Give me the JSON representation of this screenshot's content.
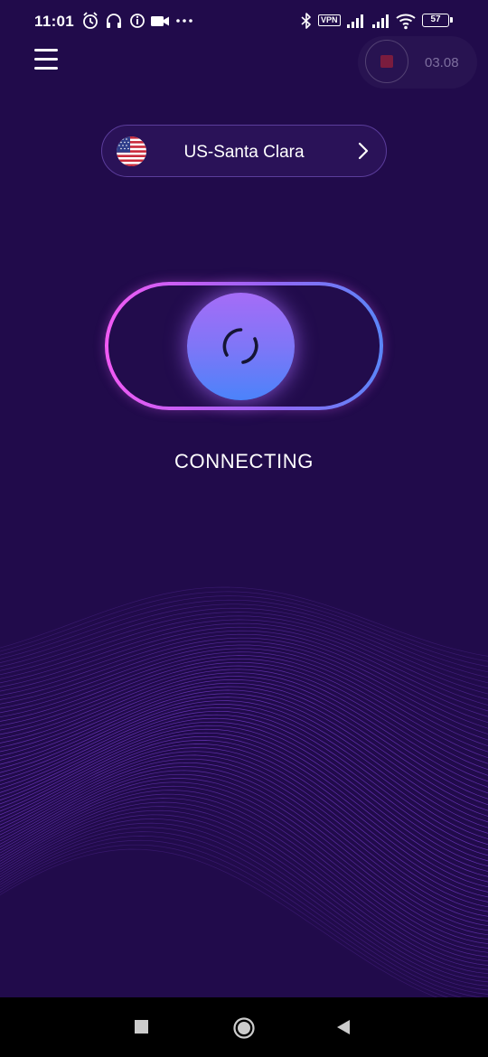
{
  "status_bar": {
    "time": "11:01",
    "icons": [
      "alarm-icon",
      "headphones-icon",
      "info-icon",
      "video-camera-icon",
      "more-dots-icon",
      "bluetooth-icon",
      "signal-icon",
      "signal-icon",
      "wifi-icon"
    ],
    "vpn_label": "VPN",
    "battery": "57"
  },
  "header": {
    "menu_icon": "hamburger-menu-icon",
    "recorder": {
      "time": "03.08",
      "accent": "#7a1c3e"
    }
  },
  "server": {
    "flag": "us-flag-icon",
    "name": "US-Santa Clara",
    "chevron": "chevron-right-icon"
  },
  "connection": {
    "status": "CONNECTING",
    "toggle_gradient": [
      "#f25af4",
      "#9c63f4",
      "#5a86f8"
    ],
    "knob_gradient": [
      "#a56cf7",
      "#4b83fa"
    ]
  },
  "colors": {
    "background": "#210b4b",
    "wave_lines": "#7a3fd0",
    "nav_bar": "#000000"
  },
  "nav_bar": {
    "buttons": [
      "recents-square-icon",
      "home-circle-icon",
      "back-triangle-icon"
    ]
  }
}
